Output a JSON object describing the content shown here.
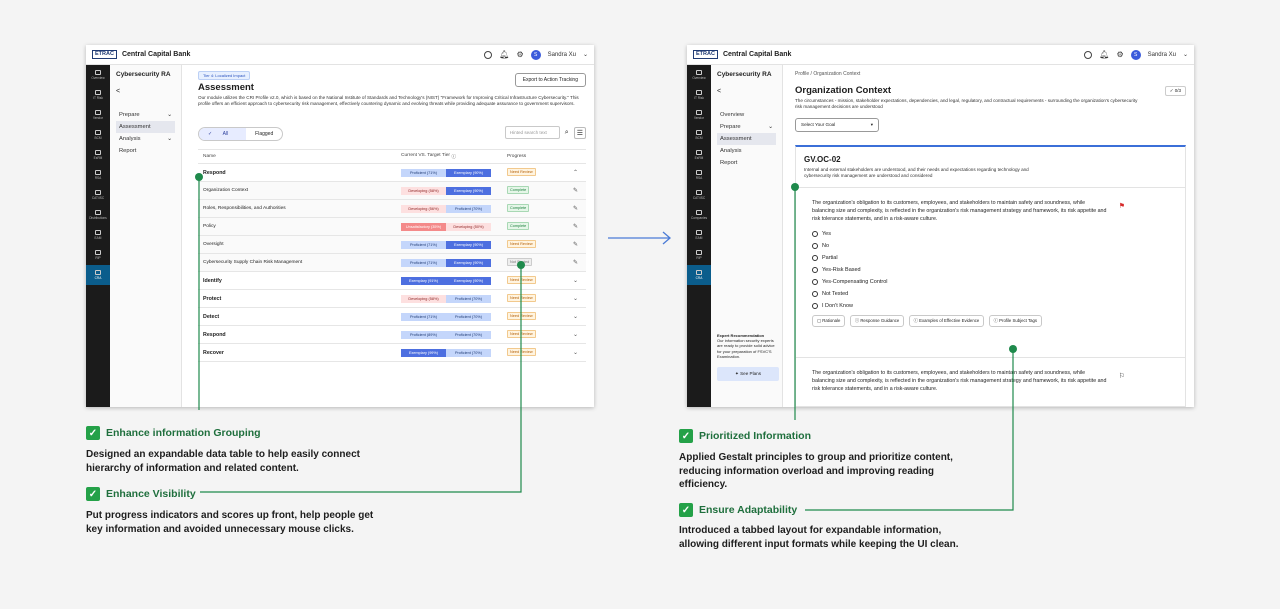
{
  "brand": {
    "logo": "ETRAC",
    "name": "Central Capital Bank"
  },
  "user": {
    "initial": "S",
    "name": "Sandra Xu"
  },
  "rail": {
    "left": [
      "Overview",
      "IT Risk",
      "Vendor",
      "BCM",
      "EsRM",
      "RSA",
      "CAT/ISC",
      "Distributions",
      "EAM",
      "RIP",
      "CRA"
    ],
    "right": [
      "Overview",
      "IT Risk",
      "Vendor",
      "BCM",
      "EsRM",
      "RSA",
      "CAT/ISC",
      "Companies",
      "EAM",
      "RIP",
      "CRA"
    ]
  },
  "left_shot": {
    "sidenav": {
      "title": "Cybersecurity RA",
      "back": "<",
      "items": [
        "Prepare",
        "Assessment",
        "Analysis",
        "Report"
      ]
    },
    "tier_tag": "Tier 4: Localized Impact",
    "export_button": "Export to Action Tracking",
    "title": "Assessment",
    "description": "Our module utilizes the CRI Profile v2.0, which is based on the National Institute of Standards and Technology's (NIST) \"Framework for Improving Critical Infrastructure Cybersecurity.\" This profile offers an efficient approach to cybersecurity risk management, effectively countering dynamic and evolving threats while providing adequate assurance to government supervisors.",
    "segments": [
      "All",
      "Flagged"
    ],
    "search_placeholder": "Hinted search text",
    "headers": [
      "Name",
      "Current VS. Target Tier",
      "Progress"
    ],
    "rows": [
      {
        "name": "Respond",
        "group": true,
        "current": "Proficient (71%)",
        "cur_class": "prof",
        "target": "Exemplary (90%)",
        "tgt_class": "ex",
        "status": "Need Review",
        "st": "nr",
        "action": "⌃"
      },
      {
        "name": "Organization Context",
        "group": false,
        "current": "Developing (58%)",
        "cur_class": "dev",
        "target": "Exemplary (90%)",
        "tgt_class": "ex",
        "status": "Complete",
        "st": "cp",
        "action": "✎"
      },
      {
        "name": "Roles, Responsibilities, and Authorities",
        "group": false,
        "current": "Developing (56%)",
        "cur_class": "dev",
        "target": "Proficient (70%)",
        "tgt_class": "prof",
        "status": "Complete",
        "st": "cp",
        "action": "✎"
      },
      {
        "name": "Policy",
        "group": false,
        "current": "Unsatisfactory (35%)",
        "cur_class": "uns",
        "target": "Developing (50%)",
        "tgt_class": "dev",
        "status": "Complete",
        "st": "cp",
        "action": "✎"
      },
      {
        "name": "Oversight",
        "group": false,
        "current": "Proficient (71%)",
        "cur_class": "prof",
        "target": "Exemplary (90%)",
        "tgt_class": "ex",
        "status": "Need Review",
        "st": "nr",
        "action": "✎"
      },
      {
        "name": "Cybersecurity Supply Chain Risk Management",
        "group": false,
        "current": "Proficient (71%)",
        "cur_class": "prof",
        "target": "Exemplary (90%)",
        "tgt_class": "ex",
        "status": "Not Started",
        "st": "ns",
        "action": "✎"
      },
      {
        "name": "Identify",
        "group": true,
        "current": "Exemplary (91%)",
        "cur_class": "ex",
        "target": "Exemplary (90%)",
        "tgt_class": "ex",
        "status": "Need Review",
        "st": "nr",
        "action": "⌄"
      },
      {
        "name": "Protect",
        "group": true,
        "current": "Developing (58%)",
        "cur_class": "dev",
        "target": "Proficient (70%)",
        "tgt_class": "prof",
        "status": "Need Review",
        "st": "nr",
        "action": "⌄"
      },
      {
        "name": "Detect",
        "group": true,
        "current": "Proficient (71%)",
        "cur_class": "prof",
        "target": "Proficient (70%)",
        "tgt_class": "prof",
        "status": "Need Review",
        "st": "nr",
        "action": "⌄"
      },
      {
        "name": "Respond",
        "group": true,
        "current": "Proficient (89%)",
        "cur_class": "prof",
        "target": "Proficient (70%)",
        "tgt_class": "prof",
        "status": "Need Review",
        "st": "nr",
        "action": "⌄"
      },
      {
        "name": "Recover",
        "group": true,
        "current": "Exemplary (99%)",
        "cur_class": "ex",
        "target": "Proficient (70%)",
        "tgt_class": "prof",
        "status": "Need Review",
        "st": "nr",
        "action": "⌄"
      }
    ]
  },
  "right_shot": {
    "sidenav": {
      "title": "Cybersecurity RA",
      "back": "<",
      "items": [
        "Overview",
        "Prepare",
        "Assessment",
        "Analysis",
        "Report"
      ]
    },
    "expert": {
      "title": "Expert Recommendation",
      "text": "Our information security experts are ready to provide solid advice for your preparation of FSVC'S Examination.",
      "button": "See Plans"
    },
    "breadcrumb": "Profile  /  Organization Context",
    "title": "Organization Context",
    "counter": "0/3",
    "description": "The circumstances - mission, stakeholder expectations, dependencies, and legal, regulatory, and contractual requirements - surrounding the organization's cybersecurity risk management decisions are understood",
    "goal_select": "Select Your Goal",
    "card_id": "GV.OC-02",
    "card_desc": "Internal and external stakeholders are understood, and their needs and expectations regarding technology and cybersecurity risk management are understood and considered",
    "question": "The organization's obligation to its customers, employees, and stakeholders to maintain safety and soundness, while balancing size and complexity, is reflected in the organization's risk management strategy and framework, its risk appetite and risk tolerance statements, and in a risk-aware culture.",
    "options": [
      "Yes",
      "No",
      "Partial",
      "Yes-Risk Based",
      "Yes-Compensating Control",
      "Not Tested",
      "I Don't Know"
    ],
    "chips": [
      "Rationale",
      "Response Guidance",
      "Examples of Effective Evidence",
      "Profile Subject Tags"
    ],
    "question2": "The organization's obligation to its customers, employees, and stakeholders to maintain safety and soundness, while balancing size and complexity, is reflected in the organization's risk management strategy and framework, its risk appetite and risk tolerance statements, and in a risk-aware culture."
  },
  "annotations": {
    "grouping": {
      "label": "Enhance information Grouping",
      "text": "Designed an expandable data table to help easily connect hierarchy of information and related content."
    },
    "visibility": {
      "label": "Enhance Visibility",
      "text": "Put progress indicators and scores up front, help people get key information and avoided unnecessary mouse clicks."
    },
    "prioritized": {
      "label": "Prioritized Information",
      "text": "Applied Gestalt principles to group and prioritize content, reducing information overload and improving reading efficiency."
    },
    "adaptability": {
      "label": "Ensure Adaptability",
      "text": "Introduced a tabbed layout for expandable information, allowing different input formats while keeping the UI clean."
    }
  },
  "colors": {
    "accent_green": "#24a148",
    "line_green": "#1f8a4c",
    "arrow_blue": "#4a7bd6",
    "rail": "#1b1b1b",
    "rail_active": "#0b5d8c"
  }
}
